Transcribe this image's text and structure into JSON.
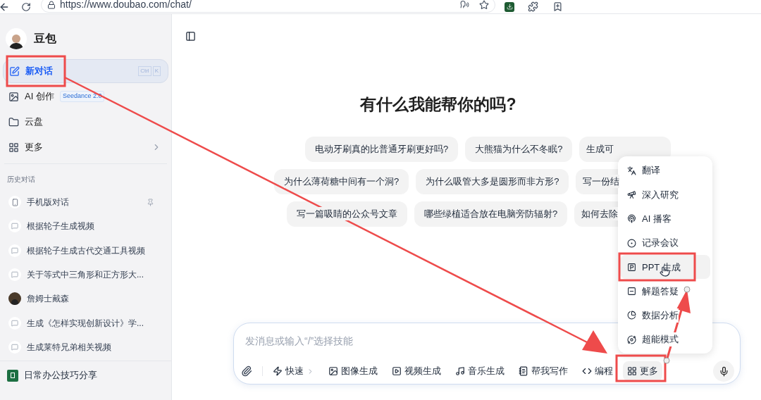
{
  "browser": {
    "url": "https://www.doubao.com/chat/"
  },
  "sidebar": {
    "app_name": "豆包",
    "nav": [
      {
        "label": "新对话",
        "selected": true,
        "shortcut": [
          "Ctrl",
          "K"
        ]
      },
      {
        "label": "AI 创作",
        "selected": false,
        "badge": "Seedance 2.0"
      },
      {
        "label": "云盘",
        "selected": false
      },
      {
        "label": "更多",
        "selected": false,
        "has_submenu": true
      }
    ],
    "history_title": "历史对话",
    "history": [
      {
        "title": "手机版对话",
        "kind": "mobile",
        "pinned": true
      },
      {
        "title": "根据轮子生成视频",
        "kind": "chat",
        "pinned": false
      },
      {
        "title": "根据轮子生成古代交通工具视频",
        "kind": "chat",
        "pinned": false
      },
      {
        "title": "关于等式中三角形和正方形大...",
        "kind": "chat",
        "pinned": false
      },
      {
        "title": "詹姆士戴森",
        "kind": "avatar",
        "pinned": false
      },
      {
        "title": "生成《怎样实现创新设计》学...",
        "kind": "chat",
        "pinned": false
      },
      {
        "title": "生成莱特兄弟相关视频",
        "kind": "chat",
        "pinned": false
      }
    ],
    "footer": {
      "label": "日常办公技巧分享"
    }
  },
  "main": {
    "heading": "有什么我能帮你的吗?",
    "suggestions": [
      [
        "电动牙刷真的比普通牙刷更好吗?",
        "大熊猫为什么不冬眠?",
        "生成可"
      ],
      [
        "为什么薄荷糖中间有一个洞?",
        "为什么吸管大多是圆形而非方形?",
        "写一份结"
      ],
      [
        "写一篇吸睛的公众号文章",
        "哪些绿植适合放在电脑旁防辐射?",
        "如何去除"
      ]
    ],
    "input": {
      "placeholder": "发消息或输入“/”选择技能",
      "tools": [
        {
          "label": "快速",
          "selected": false,
          "has_chevron": true
        },
        {
          "label": "图像生成",
          "selected": false,
          "has_chevron": false
        },
        {
          "label": "视频生成",
          "selected": false,
          "has_chevron": false
        },
        {
          "label": "音乐生成",
          "selected": false,
          "has_chevron": false
        },
        {
          "label": "帮我写作",
          "selected": false,
          "has_chevron": false
        },
        {
          "label": "编程",
          "selected": false,
          "has_chevron": false
        },
        {
          "label": "更多",
          "selected": true,
          "has_chevron": false
        }
      ]
    },
    "more_menu": [
      {
        "label": "翻译",
        "selected": false
      },
      {
        "label": "深入研究",
        "selected": false
      },
      {
        "label": "AI 播客",
        "selected": false
      },
      {
        "label": "记录会议",
        "selected": false
      },
      {
        "label": "PPT 生成",
        "selected": true
      },
      {
        "label": "解题答疑",
        "selected": false
      },
      {
        "label": "数据分析",
        "selected": false
      },
      {
        "label": "超能模式",
        "selected": false
      }
    ]
  }
}
